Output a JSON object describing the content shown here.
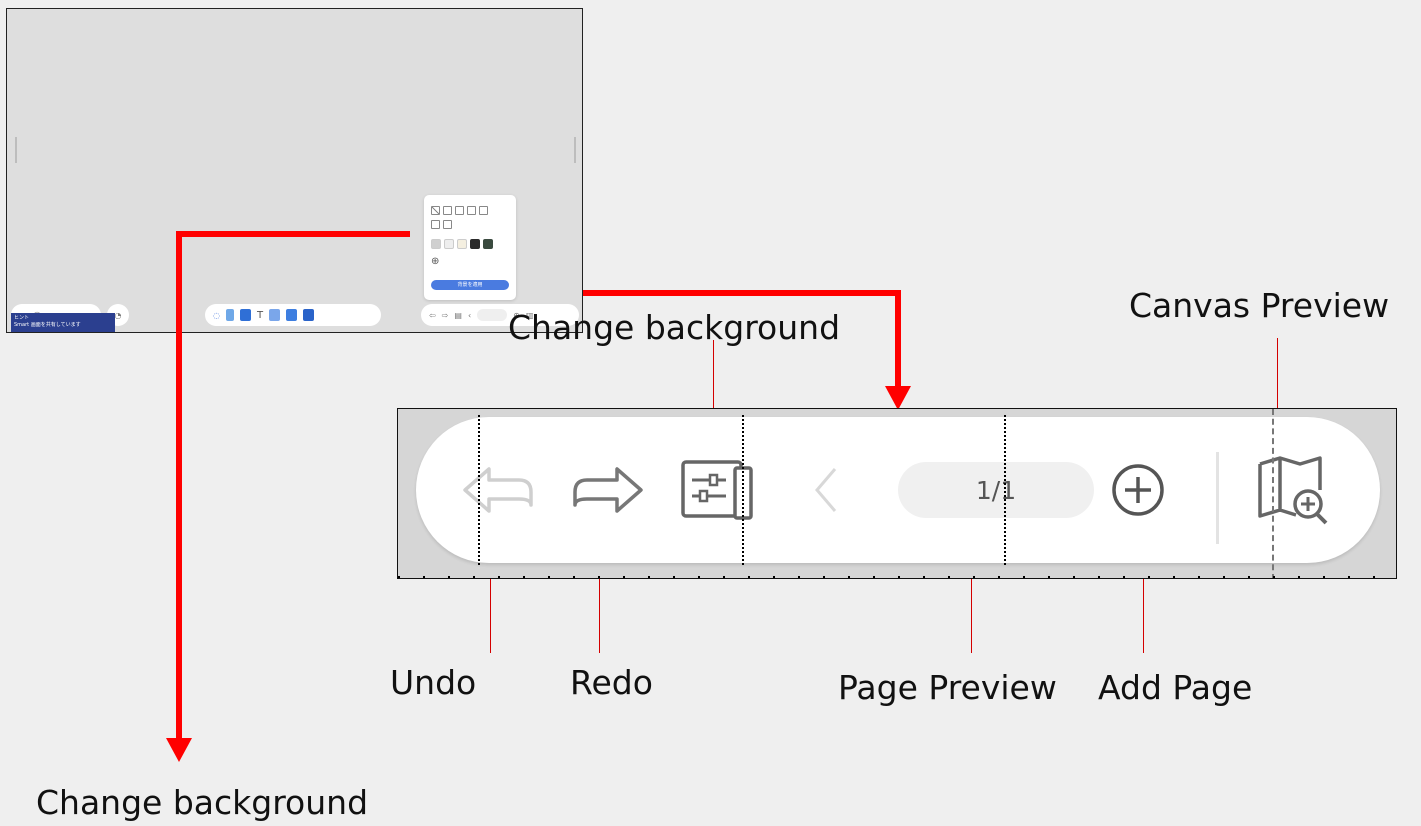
{
  "labels": {
    "undo": "Undo",
    "redo": "Redo",
    "page_preview": "Page Preview",
    "add_page": "Add Page",
    "canvas_preview": "Canvas Preview",
    "change_background_top": "Change background",
    "change_background_bottom": "Change background"
  },
  "toolbar": {
    "page_indicator": "1/1",
    "icons": [
      "undo-icon",
      "redo-icon",
      "background-settings-icon",
      "previous-page-icon",
      "add-page-icon",
      "canvas-preview-icon"
    ]
  },
  "mini_screenshot": {
    "background_panel": {
      "layout_options": 7,
      "color_swatches": [
        "#d0d0d0",
        "#eeeeee",
        "#f4efe0",
        "#2a2a2a",
        "#3a4a3f"
      ],
      "apply_label": "背景を適用"
    },
    "page_indicator": "1/1",
    "tooltip_lines": [
      "ヒント",
      "Smart 画面を共有しています"
    ]
  },
  "colors": {
    "annotation_red": "#ff0000",
    "apply_button_blue": "#4a7be0"
  }
}
